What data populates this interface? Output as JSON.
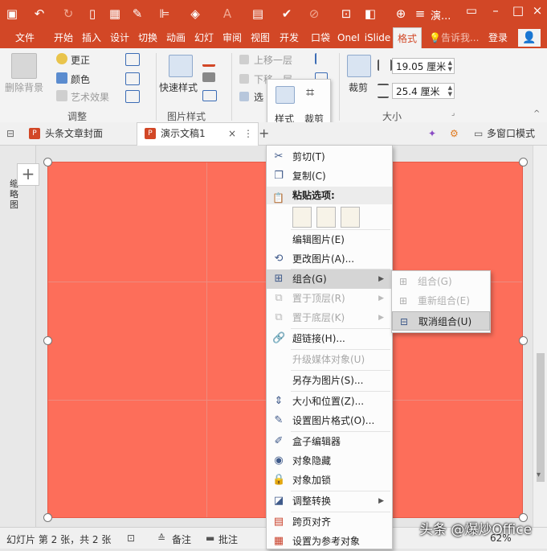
{
  "title_bar": {
    "app_title": "演..."
  },
  "ribbon_tabs": [
    "文件",
    "开始",
    "插入",
    "设计",
    "切换",
    "动画",
    "幻灯",
    "审阅",
    "视图",
    "开发",
    "口袋",
    "OneI",
    "iSlide",
    "格式"
  ],
  "active_tab": "格式",
  "tell_me": "告诉我...",
  "login": "登录",
  "ribbon": {
    "remove_bg": "删除背景",
    "corrections": "更正",
    "color": "颜色",
    "artistic": "艺术效果",
    "adjust_group": "调整",
    "quick_styles": "快速样式",
    "picture_styles_group": "图片样式",
    "bring_forward": "上移一层",
    "send_backward": "下移一层",
    "selection_pane": "选",
    "crop": "裁剪",
    "height": "19.05 厘米",
    "width": "25.4 厘米",
    "size_group": "大小"
  },
  "mini_popup": {
    "style": "样式",
    "crop": "裁剪"
  },
  "doc_tabs": {
    "tab1": "头条文章封面",
    "tab2": "演示文稿1",
    "multi_window": "多窗口模式"
  },
  "left_pane_text": "缩略图",
  "context_menu": {
    "cut": "剪切(T)",
    "copy": "复制(C)",
    "paste_options": "粘贴选项:",
    "edit_picture": "编辑图片(E)",
    "change_picture": "更改图片(A)...",
    "group": "组合(G)",
    "bring_to_front": "置于顶层(R)",
    "send_to_back": "置于底层(K)",
    "hyperlink": "超链接(H)...",
    "upgrade_media": "升级媒体对象(U)",
    "save_as_picture": "另存为图片(S)...",
    "size_position": "大小和位置(Z)...",
    "format_picture": "设置图片格式(O)...",
    "box_editor": "盒子编辑器",
    "hide_object": "对象隐藏",
    "lock_object": "对象加锁",
    "adjust_convert": "调整转换",
    "cross_page_align": "跨页对齐",
    "set_reference": "设置为参考对象"
  },
  "group_submenu": {
    "group": "组合(G)",
    "regroup": "重新组合(E)",
    "ungroup": "取消组合(U)"
  },
  "status_bar": {
    "slide_info": "幻灯片 第 2 张，共 2 张",
    "notes": "备注",
    "comments": "批注",
    "zoom": "62%"
  },
  "watermark": "头条 @爆炒Office",
  "colors": {
    "accent": "#d24726",
    "slide_fill": "#fd6e5a"
  }
}
